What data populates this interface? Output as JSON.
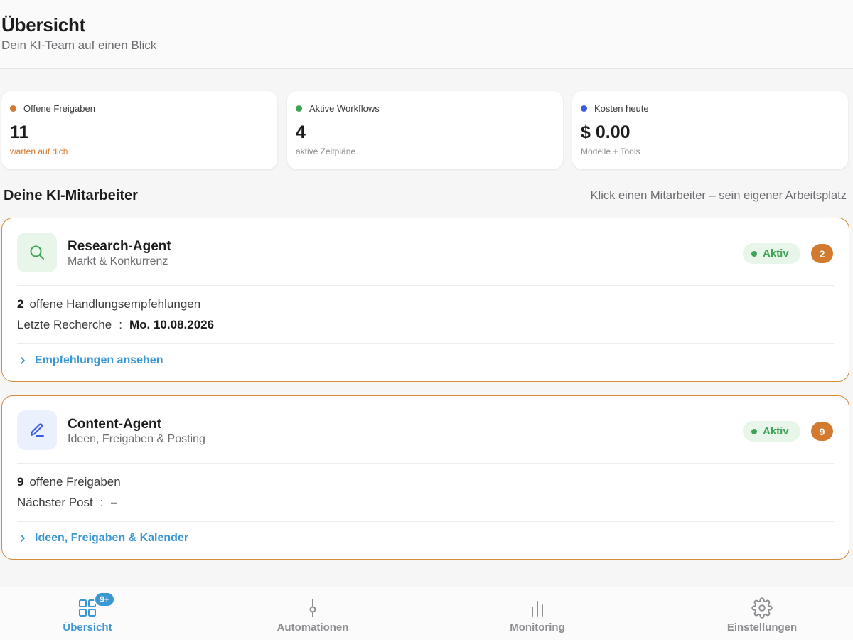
{
  "header": {
    "title": "Übersicht",
    "subtitle": "Dein KI-Team auf einen Blick"
  },
  "stats": [
    {
      "label": "Offene Freigaben",
      "value": "11",
      "sub": "warten auf dich",
      "dot_color": "#d37a2f",
      "sub_color": "#d37a2f"
    },
    {
      "label": "Aktive Workflows",
      "value": "4",
      "sub": "aktive Zeitpläne",
      "dot_color": "#3ea455",
      "sub_color": "#8e8e93"
    },
    {
      "label": "Kosten heute",
      "value": "$ 0.00",
      "sub": "Modelle + Tools",
      "dot_color": "#3a5ce0",
      "sub_color": "#8e8e93"
    }
  ],
  "section": {
    "title": "Deine KI-Mitarbeiter",
    "hint": "Klick einen Mitarbeiter – sein eigener Arbeitsplatz"
  },
  "agents": [
    {
      "name": "Research-Agent",
      "role": "Markt & Konkurrenz",
      "icon": "search-icon",
      "status": "Aktiv",
      "badge": "2",
      "metric_count": "2",
      "metric_text": "offene Handlungsempfehlungen",
      "detail_label": "Letzte Recherche",
      "detail_sep": ":",
      "detail_value": "Mo. 10.08.2026",
      "link": "Empfehlungen ansehen"
    },
    {
      "name": "Content-Agent",
      "role": "Ideen, Freigaben & Posting",
      "icon": "pen-icon",
      "status": "Aktiv",
      "badge": "9",
      "metric_count": "9",
      "metric_text": "offene Freigaben",
      "detail_label": "Nächster Post",
      "detail_sep": ":",
      "detail_value": "–",
      "link": "Ideen, Freigaben & Kalender"
    }
  ],
  "tabs": [
    {
      "label": "Übersicht",
      "icon": "grid-icon",
      "active": true,
      "badge": "9+"
    },
    {
      "label": "Automationen",
      "icon": "automation-icon",
      "active": false
    },
    {
      "label": "Monitoring",
      "icon": "bar-chart-icon",
      "active": false
    },
    {
      "label": "Einstellungen",
      "icon": "gear-icon",
      "active": false
    }
  ],
  "colors": {
    "accent": "#3a97d4",
    "warning": "#d37a2f",
    "success": "#3ea455",
    "card_border": "#d8893a"
  }
}
